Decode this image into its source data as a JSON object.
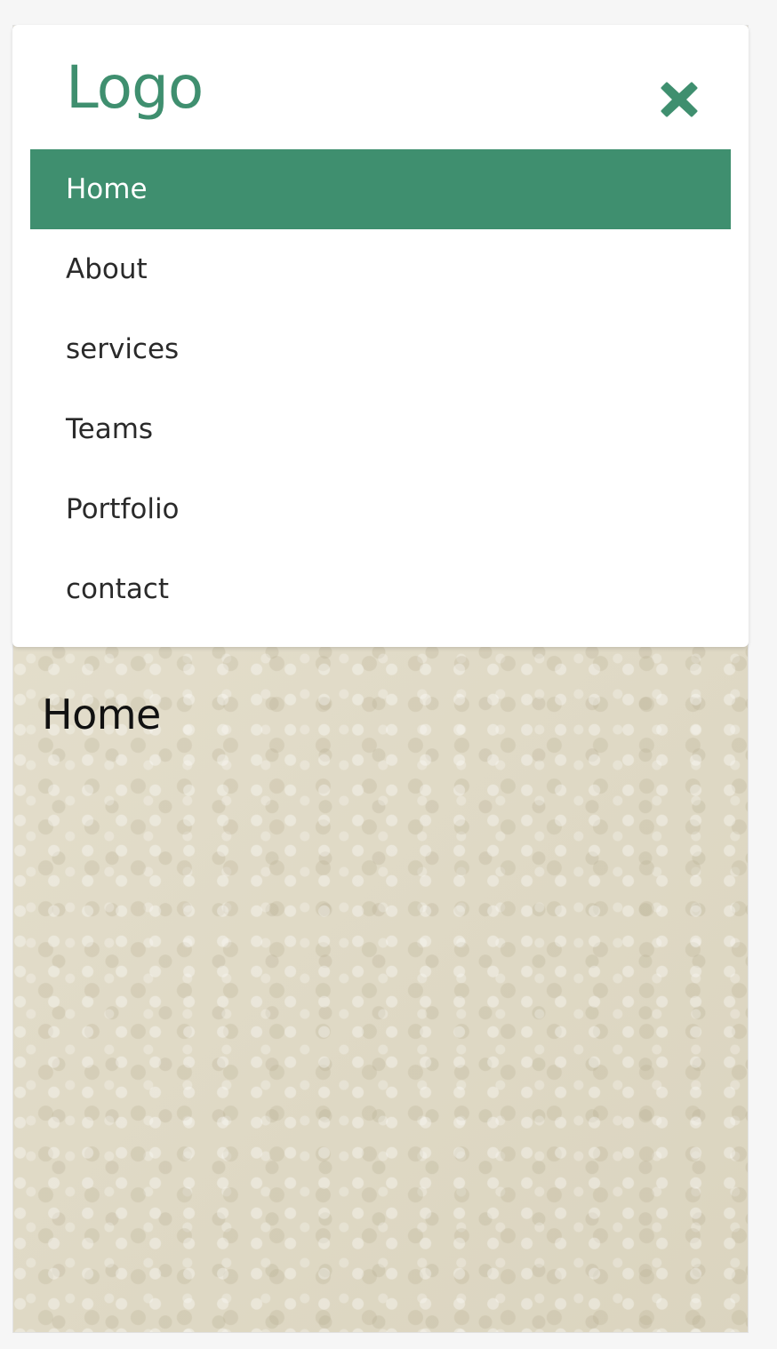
{
  "brand": {
    "logo_text": "Logo",
    "accent_color": "#3f8f6f"
  },
  "menu": {
    "close_icon": "close-icon",
    "items": [
      {
        "label": "Home",
        "active": true
      },
      {
        "label": "About",
        "active": false
      },
      {
        "label": "services",
        "active": false
      },
      {
        "label": "Teams",
        "active": false
      },
      {
        "label": "Portfolio",
        "active": false
      },
      {
        "label": "contact",
        "active": false
      }
    ]
  },
  "main": {
    "heading": "Home",
    "background_color": "#e3ddc9"
  }
}
